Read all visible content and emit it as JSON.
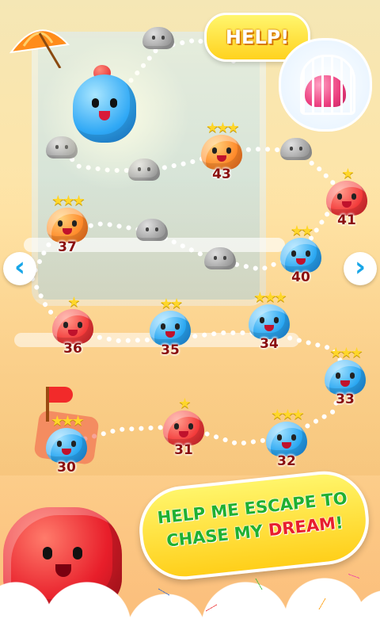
{
  "help_bubble": {
    "label": "HELP!"
  },
  "banner": {
    "line1": "HELP ME ESCAPE TO",
    "line2_prefix": "CHASE MY ",
    "line2_highlight": "DREAM",
    "line2_suffix": "!"
  },
  "nav": {
    "left_arrow_icon": "chevron-left-icon",
    "right_arrow_icon": "chevron-right-icon",
    "left_glyph": "‹",
    "right_glyph": "›"
  },
  "levels": [
    {
      "number": "30",
      "stars": 3,
      "color": "blue"
    },
    {
      "number": "31",
      "stars": 1,
      "color": "red"
    },
    {
      "number": "32",
      "stars": 3,
      "color": "blue"
    },
    {
      "number": "33",
      "stars": 3,
      "color": "blue"
    },
    {
      "number": "34",
      "stars": 3,
      "color": "blue"
    },
    {
      "number": "35",
      "stars": 2,
      "color": "blue"
    },
    {
      "number": "36",
      "stars": 1,
      "color": "red"
    },
    {
      "number": "37",
      "stars": 3,
      "color": "orange"
    },
    {
      "number": "40",
      "stars": 2,
      "color": "blue"
    },
    {
      "number": "41",
      "stars": 1,
      "color": "red"
    },
    {
      "number": "43",
      "stars": 3,
      "color": "orange"
    }
  ],
  "colors": {
    "blue": "#2aa7f2",
    "red": "#f33a3a",
    "orange": "#ff8a2a",
    "star": "#ffd62a",
    "number": "#8a0e0e",
    "banner_text": "#1fb032",
    "dream_text": "#e81e2e"
  }
}
